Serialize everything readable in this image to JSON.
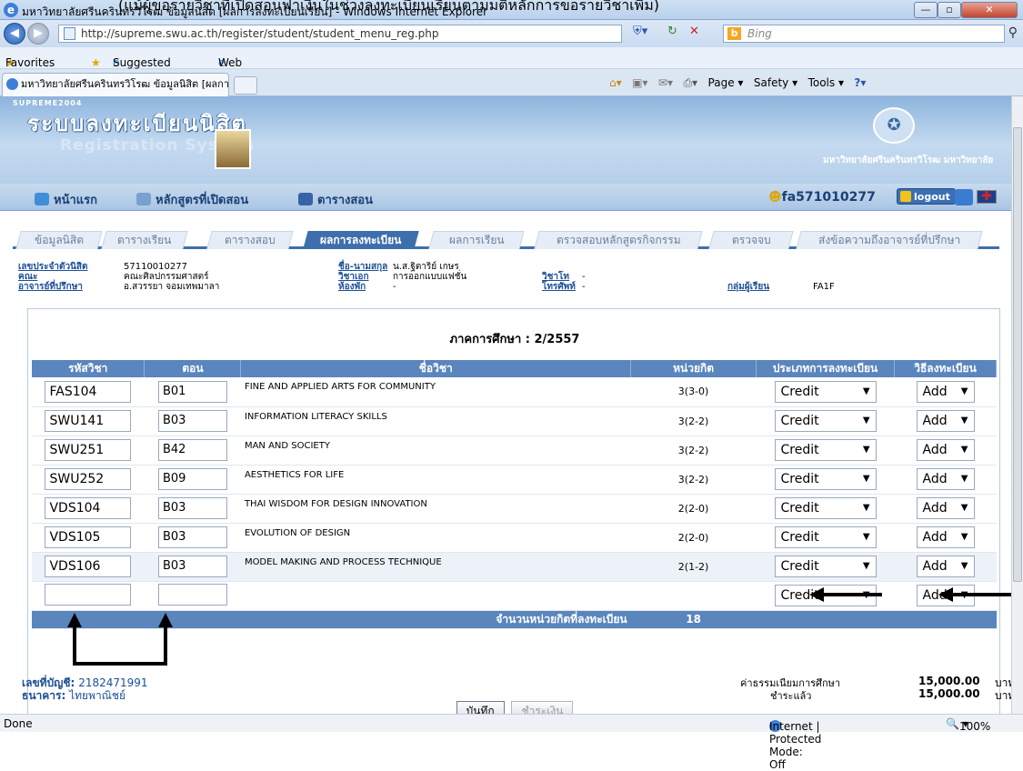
{
  "caption": "(แม้ผู้ขอรายวิชาที่เปิดสอนฟาเงินในช่วงลงทะเบียนเรียนตามมติหลักการขอรายวิชาเพิ่ม)",
  "browser": {
    "title": "มหาวิทยาลัยศรีนครินทรวิโรฒ ข้อมูลนิสิต [ผลการลงทะเบียนเรียน] - Windows Internet Explorer",
    "url": "http://supreme.swu.ac.th/register/student/student_menu_reg.php",
    "search_placeholder": "Bing",
    "search_brand": "Bing",
    "favorites_label": "Favorites",
    "fav_suggested": "Suggested Sites ▾",
    "fav_webslice": "Web Slice Gallery ▾",
    "tab_title": "มหาวิทยาลัยศรีนครินทรวิโรฒ ข้อมูลนิสิต [ผลการลงทะเบ...",
    "cmd_page": "Page ▾",
    "cmd_safety": "Safety ▾",
    "cmd_tools": "Tools ▾",
    "status_left": "Done",
    "status_zone": "Internet | Protected Mode: Off",
    "zoom": "100%"
  },
  "header": {
    "brand_small": "SUPREME2004",
    "brand_main": "ระบบลงทะเบียนนิสิต",
    "brand_sub": "Registration System",
    "uni_name": "มหาวิทยาลัยศรีนครินทรวิโรฒ มหาวิทยาลัย"
  },
  "topmenu": {
    "home": "หน้าแรก",
    "courses": "หลักสูตรที่เปิดสอน",
    "schedule": "ตารางสอน",
    "user_id": "fa571010277",
    "logout": "logout"
  },
  "subtabs": [
    "ข้อมูลนิสิต",
    "ตารางเรียน",
    "ตารางสอบ",
    "ผลการลงทะเบียน",
    "ผลการเรียน",
    "ตรวจสอบหลักสูตรกิจกรรม",
    "ตรวจจบ",
    "ส่งข้อความถึงอาจารย์ที่ปรึกษา"
  ],
  "student": {
    "id_label": "เลขประจำตัวนิสิต",
    "id_value": "57110010277",
    "faculty_label": "คณะ",
    "faculty_value": "คณะศิลปกรรมศาสตร์",
    "advisor_label": "อาจารย์ที่ปรึกษา",
    "advisor_value": "อ.สวรรยา จอมเทพมาลา",
    "name_label": "ชื่อ-นามสกุล",
    "name_value": "น.ส.ฐิตาริย์ เกษร",
    "major_label": "วิชาเอก",
    "major_value": "การออกแบบแฟชั่น",
    "room_label": "ห้องพัก",
    "room_value": "-",
    "minor_label": "วิชาโท",
    "minor_value": "-",
    "phone_label": "โทรศัพท์",
    "phone_value": "-",
    "group_label": "กลุ่มผู้เรียน",
    "group_value": "FA1F"
  },
  "semester": "ภาคการศึกษา : 2/2557",
  "table": {
    "headers": [
      "รหัสวิชา",
      "ตอน",
      "ชื่อวิชา",
      "หน่วยกิต",
      "ประเภทการลงทะเบียน",
      "วิธีลงทะเบียน"
    ],
    "rows": [
      {
        "code": "FAS104",
        "section": "B01",
        "name": "FINE AND APPLIED ARTS FOR COMMUNITY",
        "units": "3(3-0)",
        "type": "Credit",
        "method": "Add"
      },
      {
        "code": "SWU141",
        "section": "B03",
        "name": "INFORMATION LITERACY SKILLS",
        "units": "3(2-2)",
        "type": "Credit",
        "method": "Add"
      },
      {
        "code": "SWU251",
        "section": "B42",
        "name": "MAN AND SOCIETY",
        "units": "3(2-2)",
        "type": "Credit",
        "method": "Add"
      },
      {
        "code": "SWU252",
        "section": "B09",
        "name": "AESTHETICS FOR LIFE",
        "units": "3(2-2)",
        "type": "Credit",
        "method": "Add"
      },
      {
        "code": "VDS104",
        "section": "B03",
        "name": "THAI WISDOM FOR DESIGN INNOVATION",
        "units": "2(2-0)",
        "type": "Credit",
        "method": "Add"
      },
      {
        "code": "VDS105",
        "section": "B03",
        "name": "EVOLUTION OF DESIGN",
        "units": "2(2-0)",
        "type": "Credit",
        "method": "Add"
      },
      {
        "code": "VDS106",
        "section": "B03",
        "name": "MODEL MAKING AND PROCESS TECHNIQUE",
        "units": "2(1-2)",
        "type": "Credit",
        "method": "Add"
      },
      {
        "code": "",
        "section": "",
        "name": "",
        "units": "",
        "type": "Credit",
        "method": "Add"
      }
    ],
    "total_label": "จำนวนหน่วยกิตที่ลงทะเบียน",
    "total_value": "18"
  },
  "buttons": {
    "save": "บันทึก",
    "pay": "ชำระเงิน"
  },
  "account": {
    "account_label": "เลขที่บัญชี:",
    "account_value": "2182471991",
    "bank_label": "ธนาคาร:",
    "bank_value": "ไทยพาณิชย์",
    "fee_label": "ค่าธรรมเนียมการศึกษา",
    "paid_label": "ชำระแล้ว",
    "fee_amount": "15,000.00",
    "paid_amount": "15,000.00",
    "currency": "บาท"
  }
}
